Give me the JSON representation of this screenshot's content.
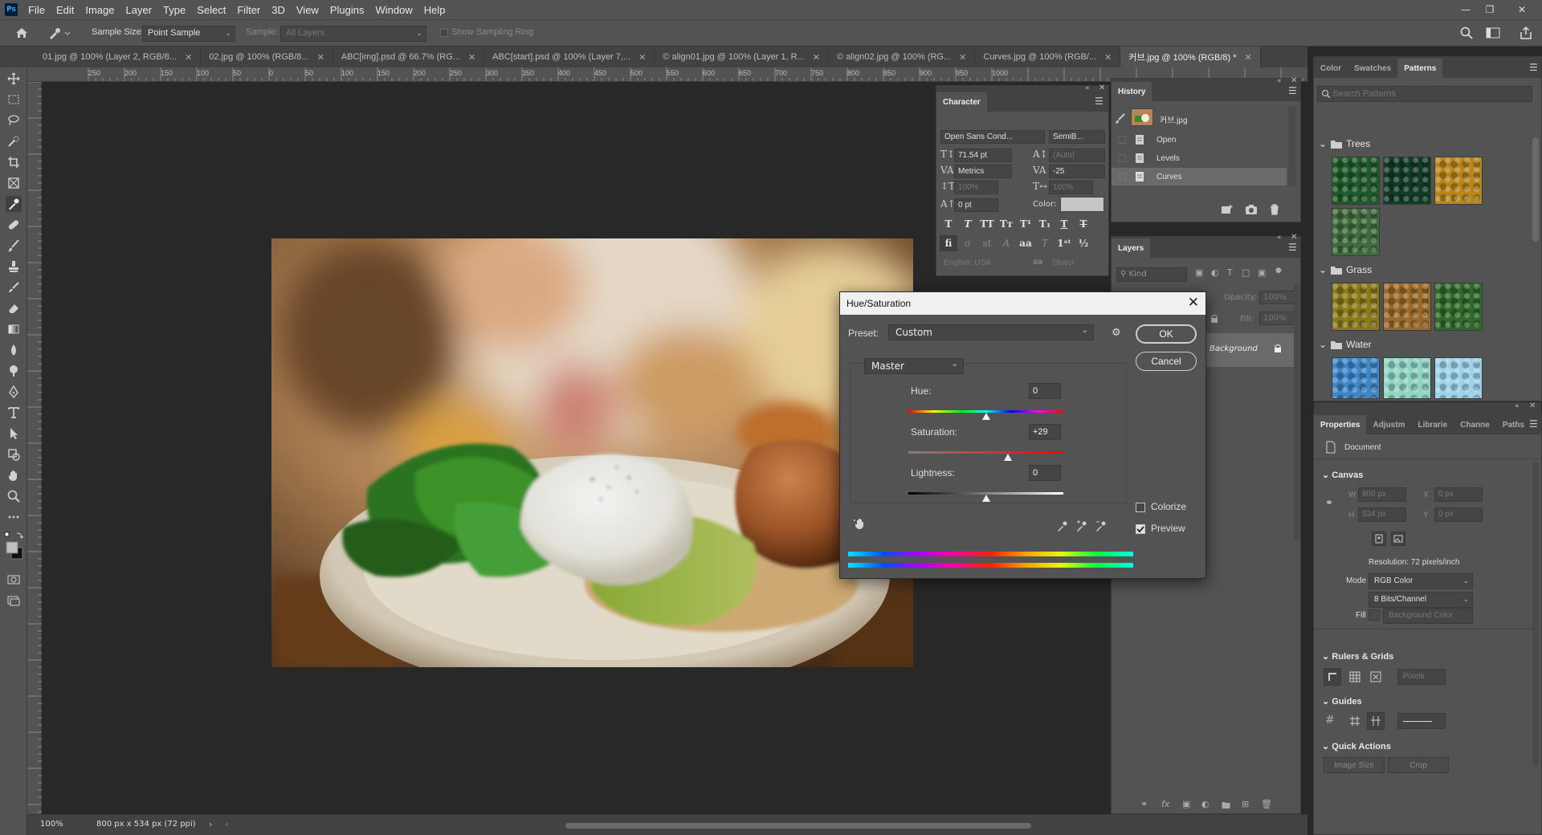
{
  "app": {
    "logo": "Ps"
  },
  "menu": [
    "File",
    "Edit",
    "Image",
    "Layer",
    "Type",
    "Select",
    "Filter",
    "3D",
    "View",
    "Plugins",
    "Window",
    "Help"
  ],
  "options_bar": {
    "sample_size_label": "Sample Size:",
    "sample_size_value": "Point Sample",
    "sample_label": "Sample:",
    "sample_value": "All Layers",
    "sampling_ring_label": "Show Sampling Ring"
  },
  "tabs": [
    {
      "label": "01.jpg @ 100% (Layer 2, RGB/8..."
    },
    {
      "label": "02.jpg @ 100% (RGB/8..."
    },
    {
      "label": "ABC[img].psd @ 66.7% (RG..."
    },
    {
      "label": "ABC[start].psd @ 100% (Layer 7,..."
    },
    {
      "label": "© align01.jpg @ 100% (Layer 1, R..."
    },
    {
      "label": "© align02.jpg @ 100% (RG..."
    },
    {
      "label": "Curves.jpg @ 100% (RGB/..."
    },
    {
      "label": "커브.jpg @ 100% (RGB/8) *"
    }
  ],
  "ruler_top": [
    "250",
    "200",
    "150",
    "100",
    "50",
    "0",
    "50",
    "100",
    "150",
    "200",
    "250",
    "300",
    "350",
    "400",
    "450",
    "500",
    "550",
    "600",
    "650",
    "700",
    "750",
    "800",
    "850",
    "900",
    "950",
    "1000"
  ],
  "status": {
    "zoom": "100%",
    "doc_info": "800 px x 534 px (72 ppi)"
  },
  "character": {
    "tab": "Character",
    "font_family": "Open Sans Cond...",
    "font_style": "SemiB...",
    "size": "71.54 pt",
    "leading": "(Auto)",
    "kerning": "Metrics",
    "tracking": "-25",
    "vscale": "100%",
    "hscale": "100%",
    "baseline": "0 pt",
    "color_label": "Color:",
    "language": "English: USA",
    "antialias": "Sharp"
  },
  "history": {
    "tab": "History",
    "snapshot": "커브.jpg",
    "items": [
      "Open",
      "Levels",
      "Curves"
    ]
  },
  "layers": {
    "tab": "Layers",
    "kind_label": "Kind",
    "opacity_label": "Opacity:",
    "opacity_value": "100%",
    "fill_label": "Fill:",
    "fill_value": "100%",
    "background_layer": "Background"
  },
  "patterns_panel": {
    "tabs": [
      "Color",
      "Swatches",
      "Patterns"
    ],
    "search_placeholder": "Search Patterns",
    "groups": [
      {
        "name": "Trees",
        "colors": [
          "#1f5a2a",
          "#123b26",
          "#b8861c",
          "#3f6a3c"
        ]
      },
      {
        "name": "Grass",
        "colors": [
          "#8a7a1a",
          "#9a6a2a",
          "#2f6a2a"
        ]
      },
      {
        "name": "Water",
        "colors": [
          "#3d86c8",
          "#8fd4c4",
          "#9ed2e8"
        ]
      }
    ]
  },
  "properties": {
    "tabs": [
      "Properties",
      "Adjustm",
      "Librarie",
      "Channe",
      "Paths"
    ],
    "doc_label": "Document",
    "canvas_title": "Canvas",
    "w_label": "W",
    "w_value": "800 px",
    "h_label": "H",
    "h_value": "534 px",
    "x_label": "X",
    "x_value": "0 px",
    "y_label": "Y",
    "y_value": "0 px",
    "resolution": "Resolution: 72 pixels/inch",
    "mode_label": "Mode",
    "mode_value": "RGB Color",
    "bits_value": "8 Bits/Channel",
    "fill_label": "Fill",
    "fill_value": "Background Color",
    "rulers_title": "Rulers & Grids",
    "units_value": "Pixels",
    "guides_title": "Guides",
    "quick_actions_title": "Quick Actions",
    "image_size_btn": "Image Size",
    "crop_btn": "Crop"
  },
  "hue_sat": {
    "title": "Hue/Saturation",
    "preset_label": "Preset:",
    "preset_value": "Custom",
    "ok": "OK",
    "cancel": "Cancel",
    "channel": "Master",
    "hue_label": "Hue:",
    "hue_value": "0",
    "saturation_label": "Saturation:",
    "saturation_value": "+29",
    "lightness_label": "Lightness:",
    "lightness_value": "0",
    "colorize_label": "Colorize",
    "colorize_checked": false,
    "preview_label": "Preview",
    "preview_checked": true,
    "hue_level": 0.5,
    "saturation_level": 0.645,
    "lightness_level": 0.5
  }
}
